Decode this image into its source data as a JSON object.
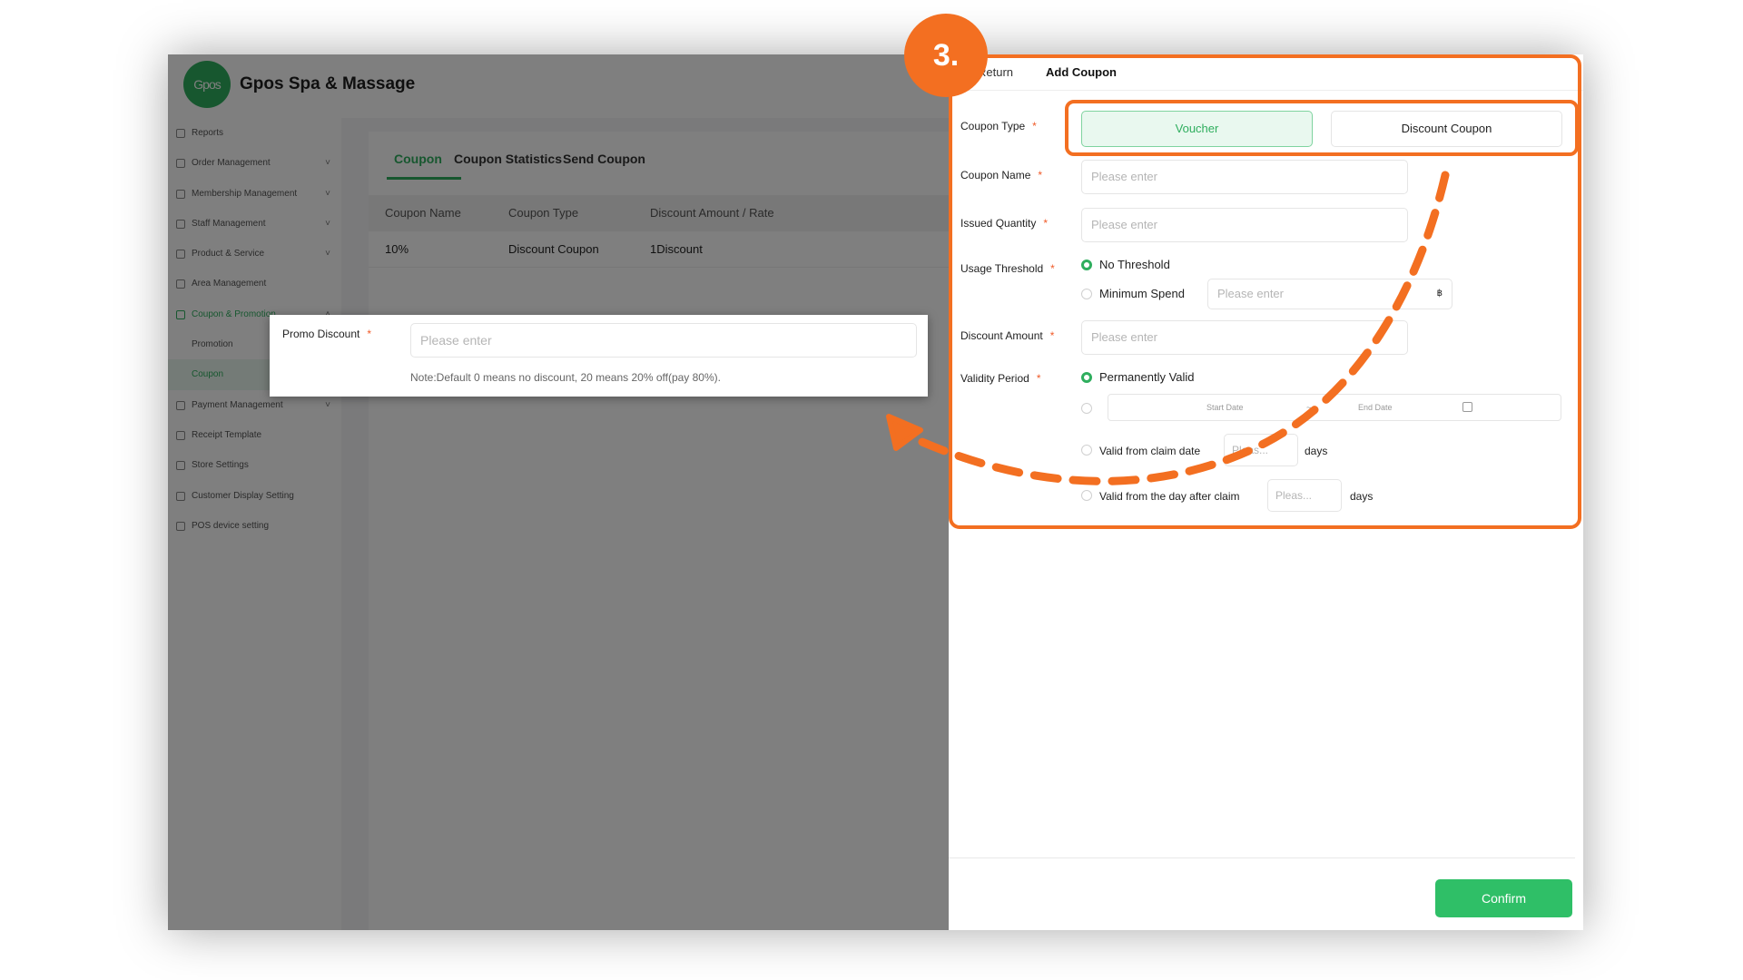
{
  "step_badge": "3.",
  "app": {
    "title": "Gpos Spa & Massage",
    "logo_text": "Gpos"
  },
  "sidebar": {
    "items": [
      {
        "label": "Reports",
        "icon": "report-icon",
        "has_chevron": false
      },
      {
        "label": "Order Management",
        "icon": "order-icon",
        "has_chevron": true
      },
      {
        "label": "Membership Management",
        "icon": "member-icon",
        "has_chevron": true
      },
      {
        "label": "Staff Management",
        "icon": "staff-icon",
        "has_chevron": true
      },
      {
        "label": "Product & Service",
        "icon": "product-icon",
        "has_chevron": true
      },
      {
        "label": "Area Management",
        "icon": "area-icon",
        "has_chevron": false
      },
      {
        "label": "Coupon & Promotion",
        "icon": "coupon-icon",
        "has_chevron": true
      },
      {
        "label": "Promotion",
        "submenu": true
      },
      {
        "label": "Coupon",
        "submenu": true,
        "selected": true
      },
      {
        "label": "Payment Management",
        "icon": "payment-icon",
        "has_chevron": true
      },
      {
        "label": "Receipt Template",
        "icon": "receipt-icon",
        "has_chevron": false
      },
      {
        "label": "Store Settings",
        "icon": "store-icon",
        "has_chevron": false
      },
      {
        "label": "Customer Display Setting",
        "icon": "display-icon",
        "has_chevron": false
      },
      {
        "label": "POS device setting",
        "icon": "device-icon",
        "has_chevron": false
      }
    ]
  },
  "tabs": [
    "Coupon",
    "Coupon Statistics",
    "Send Coupon"
  ],
  "table": {
    "headers": [
      "Coupon Name",
      "Coupon Type",
      "Discount Amount / Rate"
    ],
    "rows": [
      [
        "10%",
        "Discount Coupon",
        "1Discount"
      ]
    ]
  },
  "drawer": {
    "return_label": "Return",
    "title": "Add Coupon",
    "coupon_type_label": "Coupon Type",
    "voucher_label": "Voucher",
    "discount_coupon_label": "Discount Coupon",
    "coupon_name_label": "Coupon Name",
    "issued_quantity_label": "Issued Quantity",
    "usage_threshold_label": "Usage Threshold",
    "no_threshold_label": "No Threshold",
    "minimum_spend_label": "Minimum Spend",
    "discount_amount_label": "Discount Amount",
    "validity_period_label": "Validity Period",
    "permanently_valid_label": "Permanently Valid",
    "start_date": "Start Date",
    "end_date": "End Date",
    "date_separator": "~",
    "valid_from_claim_label": "Valid from claim date",
    "valid_from_day_after_label": "Valid from the day after claim",
    "days_label": "days",
    "placeholder": "Please enter",
    "short_placeholder": "Pleas...",
    "currency_symbol": "฿",
    "required_mark": "*",
    "confirm_label": "Confirm"
  },
  "promo_popup": {
    "label": "Promo Discount",
    "placeholder": "Please enter",
    "note": "Note:Default 0 means no discount, 20 means 20% off(pay 80%)."
  },
  "colors": {
    "brand_green": "#2fae5e",
    "highlight_orange": "#f36f21"
  }
}
